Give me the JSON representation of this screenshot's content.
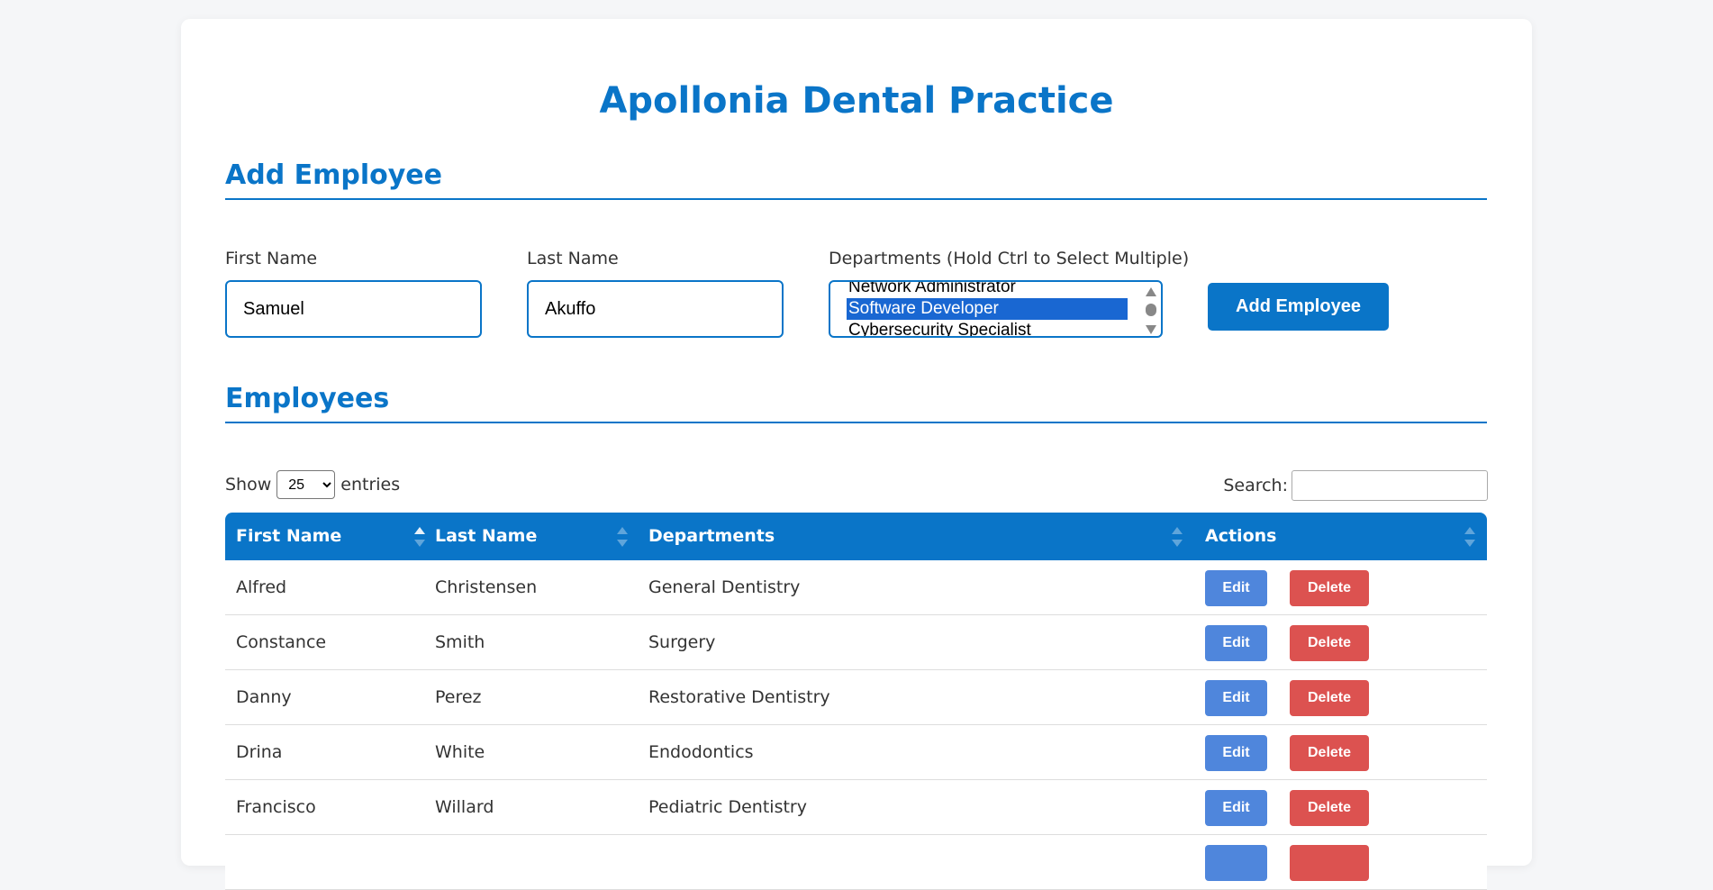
{
  "page": {
    "title": "Apollonia Dental Practice"
  },
  "add_section": {
    "heading": "Add Employee",
    "first_name_label": "First Name",
    "first_name_value": "Samuel",
    "last_name_label": "Last Name",
    "last_name_value": "Akuffo",
    "departments_label": "Departments (Hold Ctrl to Select Multiple)",
    "department_options_visible": [
      "Network Administrator",
      "Software Developer",
      "Cybersecurity Specialist"
    ],
    "selected_department": "Software Developer",
    "submit_label": "Add Employee"
  },
  "employees_section": {
    "heading": "Employees",
    "show_label": "Show",
    "entries_label": "entries",
    "page_size": "25",
    "search_label": "Search:",
    "search_value": "",
    "columns": [
      "First Name",
      "Last Name",
      "Departments",
      "Actions"
    ],
    "sorted_column": "First Name",
    "sort_direction": "ascending",
    "edit_label": "Edit",
    "delete_label": "Delete",
    "rows": [
      {
        "first": "Alfred",
        "last": "Christensen",
        "dept": "General Dentistry"
      },
      {
        "first": "Constance",
        "last": "Smith",
        "dept": "Surgery"
      },
      {
        "first": "Danny",
        "last": "Perez",
        "dept": "Restorative Dentistry"
      },
      {
        "first": "Drina",
        "last": "White",
        "dept": "Endodontics"
      },
      {
        "first": "Francisco",
        "last": "Willard",
        "dept": "Pediatric Dentistry"
      }
    ]
  },
  "colors": {
    "accent": "#0a75c8",
    "edit_button": "#4f86dc",
    "delete_button": "#dc5250",
    "selected_option": "#1967d2"
  }
}
